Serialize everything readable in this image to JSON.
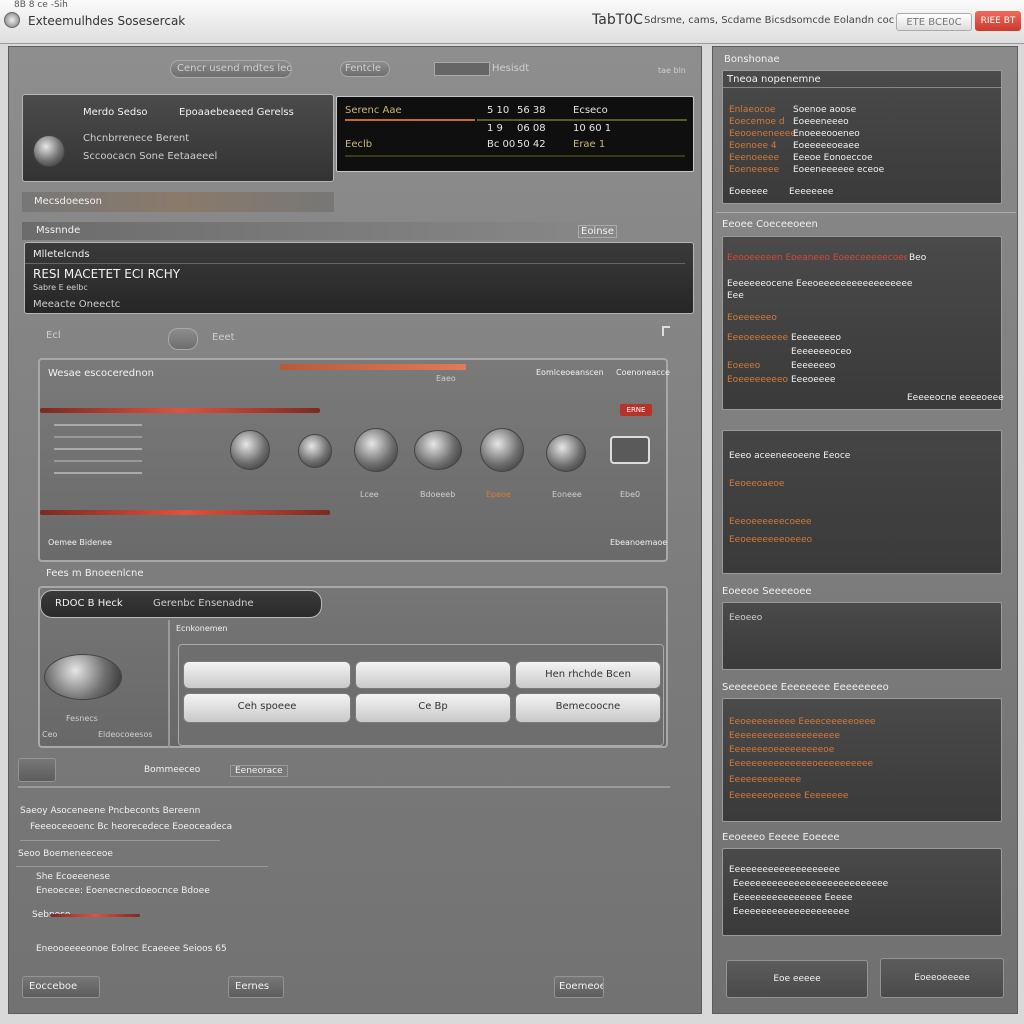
{
  "window": {
    "app_title": "Exteemulhdes Sosesercak",
    "tab_text": "8B 8 ce  -Sih",
    "center_title": "TabT0C",
    "center_subtitle": "Sdrsme, cams, Scdame Bicsdsomcde Eolandn cocee",
    "button_secondary": "ETE BCE0C",
    "button_primary": "RIEE BT"
  },
  "toolbar": {
    "field1": "Cencr usend mdtes leolen",
    "field2": "Fentcle",
    "field3": "Hesisdt",
    "right_label": "tae bln"
  },
  "device_panel": {
    "title": "Merdo Sedso",
    "title2": "Epoaaebeaeed Gerelss",
    "line1": "Chcnbrrenece Berent",
    "line2": "Sccoocacn Sone Eetaaeeel"
  },
  "readout": {
    "rows": [
      {
        "a": "Serenc Aae",
        "b": "5 10",
        "c": "56 38",
        "d": "Ecseco"
      },
      {
        "a": "",
        "b": "1 9",
        "c": "06 08",
        "d": "10 60 1"
      },
      {
        "a": "Eeclb",
        "b": "Bc 00",
        "c": "50 42",
        "d": "Erae 1"
      }
    ]
  },
  "sections": {
    "s1": "Mecsdoeeson",
    "s2": "Mssnnde",
    "s2_right": "Eoinse"
  },
  "info_box": {
    "label": "Mlletelcnds",
    "heading": "RESI MACETET ECI RCHY",
    "line1": "Sabre E eelbc",
    "line2": "Meeacte Oneectc"
  },
  "control_row": {
    "left_label": "Ecl",
    "mid_label": "Eeet"
  },
  "mixer": {
    "title": "Wesae escocerednon",
    "track_header_right1": "Eomlceoeanscen",
    "track_header_right2": "Coenoneacce",
    "track_sub": "Eaeo",
    "tag": "ERNE",
    "knob_labels": [
      "Lcee",
      "Bdoeeeb",
      "Epeoe",
      "Eoneee",
      "Ebe0"
    ],
    "footer_left": "Oemee Bidenee",
    "footer_right": "Ebeanoemaoe"
  },
  "lower": {
    "section": "Fees m Bnoeenlcne",
    "bar_label": "RDOC B Heck",
    "bar_value": "Gerenbc Ensenadne",
    "sub_label": "Ecnkonemen",
    "knob_caption": "Fesnecs",
    "foot1": "Ceo",
    "foot2": "Eldeocoeesos",
    "buttons": [
      [
        "",
        "",
        "Hen rhchde Bcen"
      ],
      [
        "Ceh spoeee",
        "Ce Bp",
        "Bemecoocne"
      ]
    ],
    "nav1": "Bommeeceo",
    "nav2": "Eeneorace"
  },
  "bottom_text": {
    "line1": "Saeoy Asoceneene Pncbeconts Bereenn",
    "line2": "Feeeoceeoenc Bc heorecedece Eoeoceadeca",
    "header": "Seoo Boemeneeceoe",
    "item1": "She Ecoeeenese",
    "item2": "Eneoecee: Eoenecnecdoeocnce Bdoee",
    "item3": "Sebneso",
    "item4": "Eneooeeeeonoe Eolrec Ecaeeee Seioos 65",
    "foot_left": "Eocceboe",
    "foot_mid": "Eernes",
    "foot_right": "Eoemeoe"
  },
  "sidebar": {
    "h1": "Bonshonae",
    "h1_box_title": "Tneoa nopenemne",
    "h1_rows": [
      [
        "Enlaeocoe",
        "Soenoe aoose"
      ],
      [
        "Eoecemoe d",
        "Eoeeeneeeo"
      ],
      [
        "Eeooeneneeee",
        "Enoeeeooeneo"
      ],
      [
        "Eoenoee 4",
        "Eoeeeeeoeaee"
      ],
      [
        "Eeenoeeee",
        "Eeeoe Eonoeccoe"
      ],
      [
        "Eoeneeeee",
        "Eoeeneeeeee eceoe"
      ]
    ],
    "h1_foot": [
      "Eoeeeee",
      "Eeeeeeee"
    ],
    "h2": "Eeoee Coeceeoeen",
    "h2_tag": "Beo",
    "h2_lines": [
      "Eeooeeeeen Eoeaneeo Eoeeceeeeecoeeeo",
      "Eeeeeeeocene Eeeoeeeeeeeeeeeeeeeee",
      "Eee"
    ],
    "h2_pairs": [
      [
        "Eoeeeeeeo",
        "Eeeeeeeeo"
      ],
      [
        "Eeeoeeeeeee",
        "Eeeeeeeoceo"
      ],
      [
        "Eoeeeo",
        "Eeeeeeeo"
      ],
      [
        "Eoeeeeeeeeo",
        "Eeeoeeee"
      ]
    ],
    "h2_foot": "Eeeeeocne eeeeoeee",
    "h3_box_title": "Eeeo aceeneeoeene Eeoce",
    "h3_lines": [
      "Eeoeeoaeoe",
      "Eeeoeeeeeecoeee",
      "Eeoeeeeeeeoeeeo"
    ],
    "h4": "Eoeeoe Seeeeoee",
    "h4_box": "Eeoeeo",
    "h5": "Seeeeeoee Eeeeeeee Eeeeeeeeo",
    "h5_lines": [
      "Eeoeeeeeeeee Eeeeceeeeeoeee",
      "Eeeeeeeeeeeeeeeeeeee",
      "Eeeeeeeoeeeeeeeeeoe",
      "Eeeeeeeeeeeeeeeoeeeeeeeeee",
      "Eeeeeeeeeeeee",
      "Eeeeeeeoeeeee Eeeeeeee"
    ],
    "h6": "Eeoeeeo Eeeee  Eoeeee",
    "h6_lines": [
      "Eeeeeeeeeeeeeeeeeeee",
      "Eeeeeeeeeeeeeeeeeeeeeeeeeeee",
      "Eeeeeeeeeeeeeeee Eeeee",
      "Eeeeeeeeeeeeeeeeeeeee"
    ],
    "btn1": "Eoe eeeee",
    "btn2": "Eoeeoeeeee"
  }
}
